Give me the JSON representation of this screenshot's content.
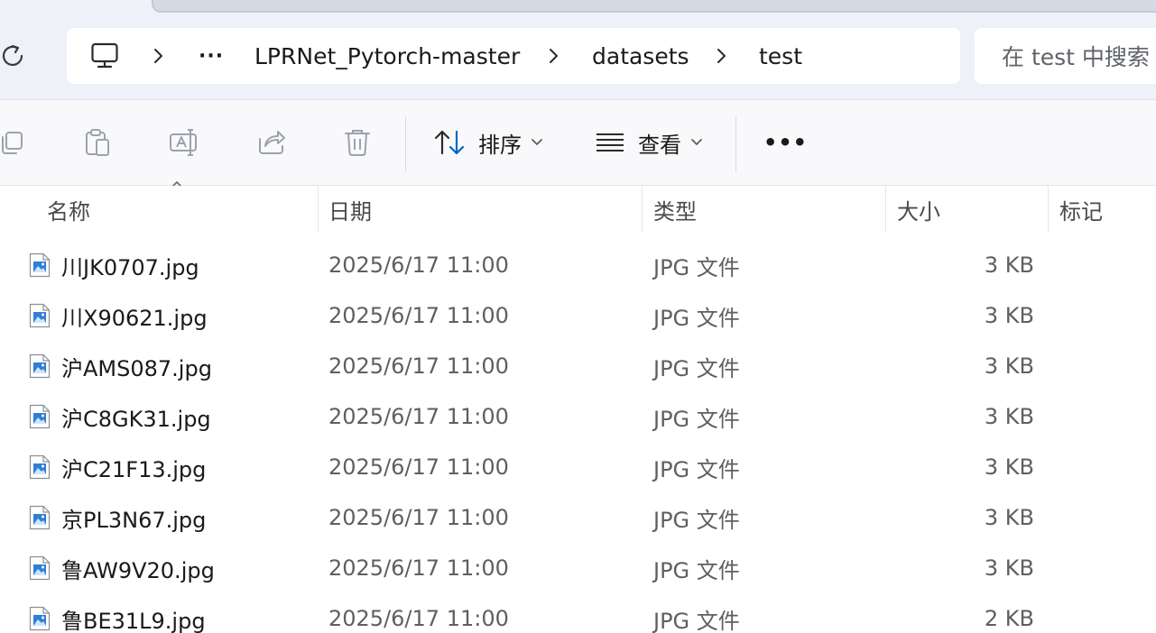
{
  "address": {
    "more_label": "···",
    "crumbs": [
      "LPRNet_Pytorch-master",
      "datasets",
      "test"
    ],
    "search_placeholder": "在 test 中搜索"
  },
  "toolbar": {
    "sort_label": "排序",
    "view_label": "查看",
    "more_label": "•••"
  },
  "columns": {
    "name": "名称",
    "date": "日期",
    "type": "类型",
    "size": "大小",
    "tags": "标记"
  },
  "files": [
    {
      "name": "川JK0707.jpg",
      "date": "2025/6/17 11:00",
      "type": "JPG 文件",
      "size": "3 KB"
    },
    {
      "name": "川X90621.jpg",
      "date": "2025/6/17 11:00",
      "type": "JPG 文件",
      "size": "3 KB"
    },
    {
      "name": "沪AMS087.jpg",
      "date": "2025/6/17 11:00",
      "type": "JPG 文件",
      "size": "3 KB"
    },
    {
      "name": "沪C8GK31.jpg",
      "date": "2025/6/17 11:00",
      "type": "JPG 文件",
      "size": "3 KB"
    },
    {
      "name": "沪C21F13.jpg",
      "date": "2025/6/17 11:00",
      "type": "JPG 文件",
      "size": "3 KB"
    },
    {
      "name": "京PL3N67.jpg",
      "date": "2025/6/17 11:00",
      "type": "JPG 文件",
      "size": "3 KB"
    },
    {
      "name": "鲁AW9V20.jpg",
      "date": "2025/6/17 11:00",
      "type": "JPG 文件",
      "size": "3 KB"
    },
    {
      "name": "鲁BE31L9.jpg",
      "date": "2025/6/17 11:00",
      "type": "JPG 文件",
      "size": "2 KB"
    }
  ],
  "colors": {
    "accent": "#0067c0",
    "address_bg": "#eef1f7",
    "toolbar_bg": "#f9f9fb",
    "disabled_icon": "#9aa3ad"
  },
  "icons": {
    "refresh": "refresh-icon",
    "computer": "computer-icon",
    "chevron": "chevron-right-icon",
    "copy": "copy-icon",
    "paste": "paste-icon",
    "rename": "rename-icon",
    "share": "share-icon",
    "delete": "trash-icon",
    "sort": "sort-icon",
    "view": "view-icon",
    "file": "image-file-icon"
  }
}
